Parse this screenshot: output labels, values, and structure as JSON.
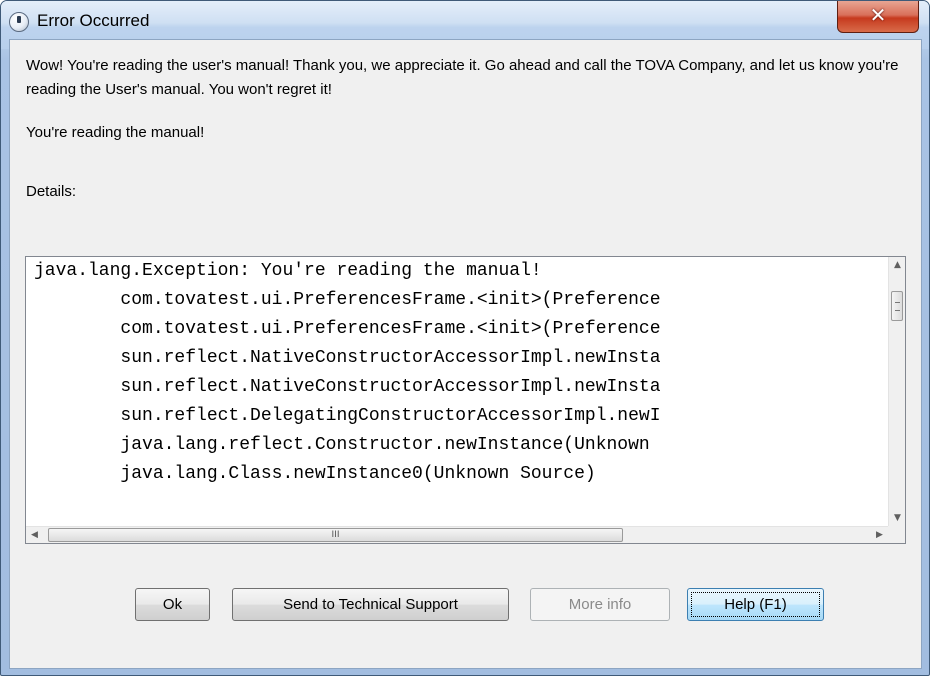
{
  "window": {
    "title": "Error Occurred",
    "close_label": "✕"
  },
  "message": {
    "text": "Wow! You're reading the user's manual! Thank you, we appreciate it. Go ahead and call the TOVA Company, and let us know you're reading the User's manual. You won't regret it!",
    "summary": "You're reading the manual!"
  },
  "details": {
    "label": "Details:",
    "lines": [
      "java.lang.Exception: You're reading the manual!",
      "        com.tovatest.ui.PreferencesFrame.<init>(Preference",
      "        com.tovatest.ui.PreferencesFrame.<init>(Preference",
      "        sun.reflect.NativeConstructorAccessorImpl.newInsta",
      "        sun.reflect.NativeConstructorAccessorImpl.newInsta",
      "        sun.reflect.DelegatingConstructorAccessorImpl.newI",
      "        java.lang.reflect.Constructor.newInstance(Unknown ",
      "        java.lang.Class.newInstance0(Unknown Source)"
    ],
    "scroll_up": "▲",
    "scroll_down": "▼",
    "scroll_left": "◀",
    "scroll_right": "▶",
    "hthumb_grip": "III"
  },
  "buttons": {
    "ok": "Ok",
    "send": "Send to Technical Support",
    "more": "More info",
    "help": "Help (F1)"
  }
}
